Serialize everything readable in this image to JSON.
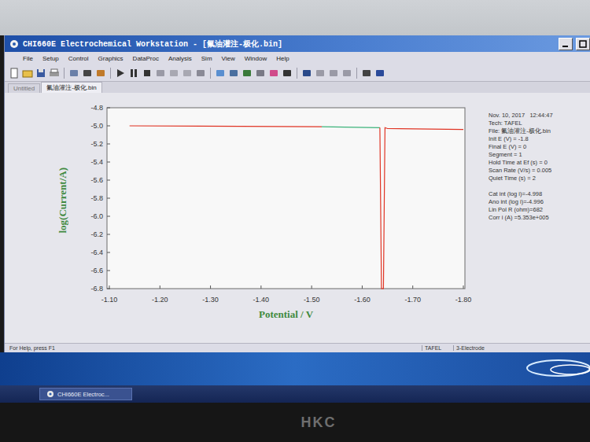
{
  "window": {
    "title": "CHI660E Electrochemical Workstation - [氟油灌注-极化.bin]"
  },
  "menu": [
    "File",
    "Setup",
    "Control",
    "Graphics",
    "DataProc",
    "Analysis",
    "Sim",
    "View",
    "Window",
    "Help"
  ],
  "tabs": [
    {
      "label": "Untitled",
      "selected": false
    },
    {
      "label": "氟油灌注-极化.bin",
      "selected": true
    }
  ],
  "chart": {
    "y_label": "log(Current/A)",
    "x_label": "Potential / V",
    "y_ticks": [
      "-4.8",
      "-5.0",
      "-5.2",
      "-5.4",
      "-5.6",
      "-5.8",
      "-6.0",
      "-6.2",
      "-6.4",
      "-6.6",
      "-6.8"
    ],
    "x_ticks": [
      "-1.10",
      "-1.20",
      "-1.30",
      "-1.40",
      "-1.50",
      "-1.60",
      "-1.70",
      "-1.80"
    ],
    "series": [
      {
        "color": "#e03424",
        "x": [
          -1.14,
          -1.52
        ],
        "y": [
          -5.0,
          -5.01
        ]
      },
      {
        "color": "#3cb37a",
        "x": [
          -1.52,
          -1.635
        ],
        "y": [
          -5.01,
          -5.02
        ]
      },
      {
        "color": "#e03424",
        "x": [
          -1.635,
          -1.638,
          -1.642,
          -1.645,
          -1.65,
          -1.8
        ],
        "y": [
          -5.02,
          -6.8,
          -6.8,
          -5.02,
          -5.03,
          -5.04
        ]
      }
    ]
  },
  "info": {
    "header": [
      "Nov. 10, 2017   12:44:47",
      "Tech: TAFEL",
      "File: 氟油灌注-极化.bin",
      "Init E (V) = -1.8",
      "Final E (V) = 0",
      "Segment = 1",
      "Hold Time at Ef (s) = 0",
      "Scan Rate (V/s) = 0.005",
      "Quiet Time (s) = 2"
    ],
    "results": [
      "Cat int (log i)=-4.998",
      "Ano int (log i)=-4.996",
      "Lin Pol R (ohm)=682",
      "Corr i (A) =5.353e+005"
    ]
  },
  "status_bar": {
    "help": "For Help, press F1",
    "technique": "TAFEL",
    "mode": "3-Electrode"
  },
  "taskbar": {
    "button": "CHI660E Electroc..."
  },
  "monitor": {
    "brand": "HKC"
  }
}
